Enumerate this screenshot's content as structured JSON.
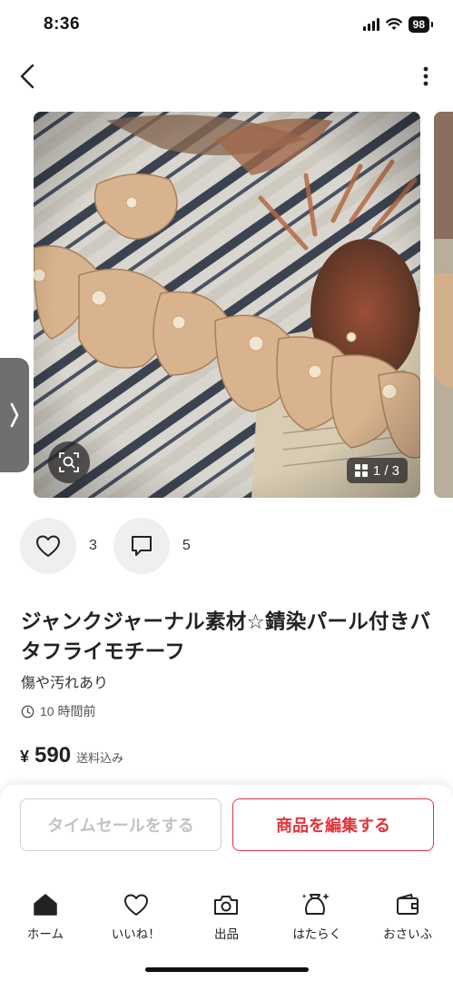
{
  "status_bar": {
    "time": "8:36",
    "battery": "98"
  },
  "product": {
    "photo_counter": "1 / 3",
    "like_count": "3",
    "comment_count": "5",
    "title": "ジャンクジャーナル素材☆錆染パール付きバタフライモチーフ",
    "condition": "傷や汚れあり",
    "posted": "10 時間前",
    "price_symbol": "¥",
    "price": "590",
    "shipping_note": "送料込み"
  },
  "buttons": {
    "timesale": "タイムセールをする",
    "edit": "商品を編集する"
  },
  "tabbar": {
    "home": "ホーム",
    "likes": "いいね！",
    "sell": "出品",
    "work": "はたらく",
    "wallet": "おさいふ"
  },
  "colors": {
    "accent": "#e3343b",
    "disabled_text": "#c3c3c3"
  }
}
